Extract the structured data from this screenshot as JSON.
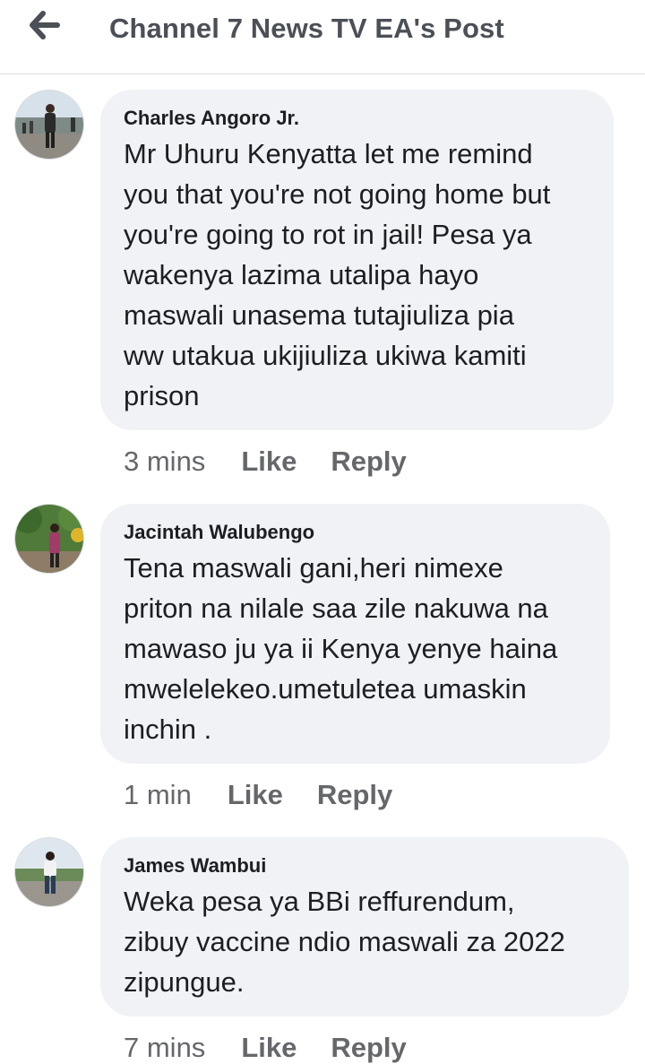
{
  "header": {
    "title": "Channel 7 News TV EA's Post",
    "back_icon": "arrow-left-icon"
  },
  "comments": [
    {
      "author": "Charles Angoro Jr.",
      "text": "Mr Uhuru Kenyatta let me remind\nyou that you're not going home but\nyou're going to rot in jail! Pesa ya\nwakenya lazima utalipa hayo\nmaswali unasema tutajiuliza pia\nww utakua ukijiuliza ukiwa kamiti\nprison",
      "time": "3 mins",
      "like_label": "Like",
      "reply_label": "Reply"
    },
    {
      "author": "Jacintah Walubengo",
      "text": "Tena maswali gani,heri nimexe\npriton na nilale saa zile nakuwa na\nmawaso ju ya ii Kenya yenye haina\nmwelelekeo.umetuletea umaskin\ninchin .",
      "time": "1 min",
      "like_label": "Like",
      "reply_label": "Reply"
    },
    {
      "author": "James Wambui",
      "text": "Weka pesa ya BBi reffurendum,\nzibuy vaccine ndio maswali za 2022\nzipungue.",
      "time": "7 mins",
      "like_label": "Like",
      "reply_label": "Reply"
    }
  ],
  "colors": {
    "bubble_bg": "#f0f2f5",
    "meta_text": "#65676b",
    "title_text": "#4b4f56",
    "body_text": "#1c1e21"
  }
}
